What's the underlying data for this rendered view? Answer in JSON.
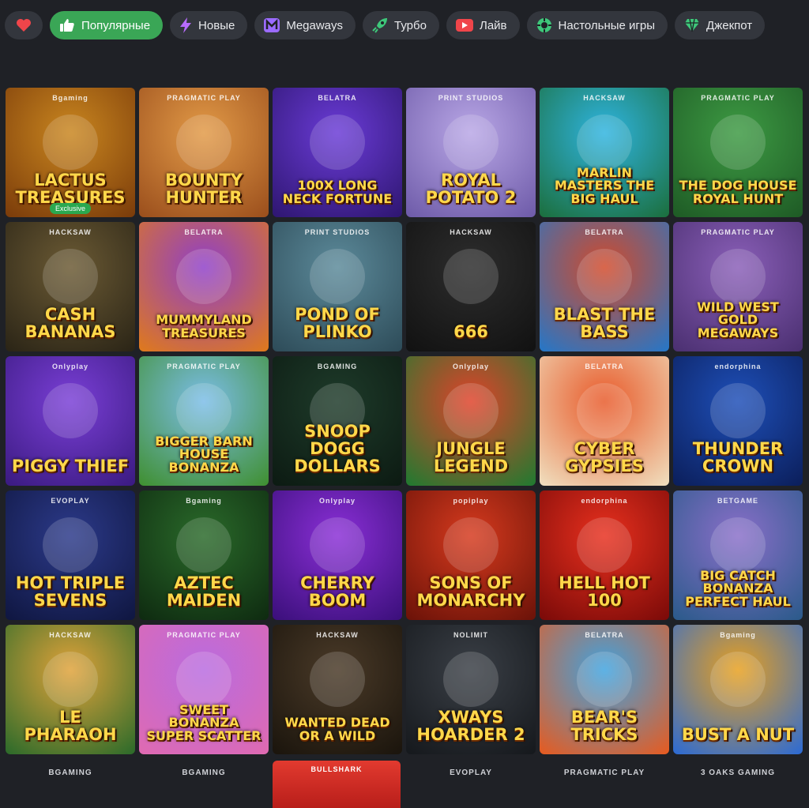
{
  "filters": [
    {
      "label": "",
      "icon": "heart-icon",
      "icon_color": "#f0454a",
      "active": false
    },
    {
      "label": "Популярные",
      "icon": "thumbs-up-icon",
      "icon_color": "#ffffff",
      "active": true
    },
    {
      "label": "Новые",
      "icon": "lightning-icon",
      "icon_color": "#b86bff",
      "active": false
    },
    {
      "label": "Megaways",
      "icon": "megaways-icon",
      "icon_color": "#9b6bff",
      "active": false
    },
    {
      "label": "Турбо",
      "icon": "rocket-icon",
      "icon_color": "#3ec77a",
      "active": false
    },
    {
      "label": "Лайв",
      "icon": "video-camera-icon",
      "icon_color": "#f0454a",
      "active": false
    },
    {
      "label": "Настольные игры",
      "icon": "chip-icon",
      "icon_color": "#3ec77a",
      "active": false
    },
    {
      "label": "Джекпот",
      "icon": "diamond-icon",
      "icon_color": "#3ec77a",
      "active": false
    }
  ],
  "games": [
    {
      "title": "Lactus Treasures",
      "provider": "Bgaming",
      "badge": "Exclusive",
      "bg": "#c9861f",
      "bg2": "#7a3b0a"
    },
    {
      "title": "Bounty Hunter",
      "provider": "PRAGMATIC PLAY",
      "badge": "",
      "bg": "#e29a47",
      "bg2": "#9a4e1c"
    },
    {
      "title": "100x Long Neck Fortune",
      "provider": "BELATRA",
      "badge": "",
      "bg": "#6a3bd6",
      "bg2": "#2e1670"
    },
    {
      "title": "Royal Potato 2",
      "provider": "PRINT STUDIOS",
      "badge": "",
      "bg": "#b9a7e6",
      "bg2": "#6d5aa8"
    },
    {
      "title": "Marlin Masters The Big Haul",
      "provider": "HACKSAW",
      "badge": "",
      "bg": "#2fb4e0",
      "bg2": "#1b6e3c"
    },
    {
      "title": "The Dog House Royal Hunt",
      "provider": "PRAGMATIC PLAY",
      "badge": "",
      "bg": "#3d9a43",
      "bg2": "#1e5a25"
    },
    {
      "title": "Cash Bananas",
      "provider": "HACKSAW",
      "badge": "",
      "bg": "#6b5a34",
      "bg2": "#2a2416"
    },
    {
      "title": "Mummyland Treasures",
      "provider": "BELATRA",
      "badge": "",
      "bg": "#8f3fc9",
      "bg2": "#e07a1a"
    },
    {
      "title": "Pond of Plinko",
      "provider": "PRINT STUDIOS",
      "badge": "",
      "bg": "#5c8a9a",
      "bg2": "#2d4b58"
    },
    {
      "title": "666",
      "provider": "HACKSAW",
      "badge": "",
      "bg": "#2d2d2d",
      "bg2": "#111111"
    },
    {
      "title": "Blast the Bass",
      "provider": "BELATRA",
      "badge": "",
      "bg": "#d24a2a",
      "bg2": "#2477c9"
    },
    {
      "title": "Wild West Gold Megaways",
      "provider": "PRAGMATIC PLAY",
      "badge": "",
      "bg": "#8a5fb8",
      "bg2": "#4a2f70"
    },
    {
      "title": "Piggy Thief",
      "provider": "Onlyplay",
      "badge": "",
      "bg": "#7a3fd6",
      "bg2": "#3a1a80"
    },
    {
      "title": "Bigger Barn House Bonanza",
      "provider": "PRAGMATIC PLAY",
      "badge": "",
      "bg": "#7bbde8",
      "bg2": "#3f8f2f"
    },
    {
      "title": "Snoop Dogg Dollars",
      "provider": "BGAMING",
      "badge": "",
      "bg": "#1e3b2a",
      "bg2": "#0c1a12"
    },
    {
      "title": "Jungle Legend",
      "provider": "Onlyplay",
      "badge": "",
      "bg": "#e0422a",
      "bg2": "#1f7a30"
    },
    {
      "title": "Cyber Gypsies",
      "provider": "BELATRA",
      "badge": "",
      "bg": "#e85a2a",
      "bg2": "#f0e0c0"
    },
    {
      "title": "Thunder Crown",
      "provider": "endorphina",
      "badge": "",
      "bg": "#1e4fb8",
      "bg2": "#0b1e5a"
    },
    {
      "title": "Hot Triple Sevens",
      "provider": "EVOPLAY",
      "badge": "",
      "bg": "#2c3a8a",
      "bg2": "#0f1640"
    },
    {
      "title": "Aztec Maiden",
      "provider": "Bgaming",
      "badge": "",
      "bg": "#2a6a2a",
      "bg2": "#0e2a10"
    },
    {
      "title": "Cherry Boom",
      "provider": "Onlyplay",
      "badge": "",
      "bg": "#8a2fd6",
      "bg2": "#3a0f7a"
    },
    {
      "title": "Sons of Monarchy",
      "provider": "popiplay",
      "badge": "",
      "bg": "#d63a1e",
      "bg2": "#6a1208"
    },
    {
      "title": "Hell Hot 100",
      "provider": "endorphina",
      "badge": "",
      "bg": "#e8301e",
      "bg2": "#7a0a08"
    },
    {
      "title": "Big Catch Bonanza Perfect Haul",
      "provider": "BETGAME",
      "badge": "",
      "bg": "#8a6fc9",
      "bg2": "#2a5a8a"
    },
    {
      "title": "Le Pharaoh",
      "provider": "HACKSAW",
      "badge": "",
      "bg": "#e0a23a",
      "bg2": "#2a6a2a"
    },
    {
      "title": "Sweet Bonanza Super Scatter",
      "provider": "PRAGMATIC PLAY",
      "badge": "",
      "bg": "#b86be0",
      "bg2": "#e06ab0"
    },
    {
      "title": "Wanted Dead or a Wild",
      "provider": "HACKSAW",
      "badge": "",
      "bg": "#4a3a28",
      "bg2": "#1a140c"
    },
    {
      "title": "xWays Hoarder 2",
      "provider": "NOLIMIT",
      "badge": "",
      "bg": "#3a3f46",
      "bg2": "#15181c"
    },
    {
      "title": "Bear's Tricks",
      "provider": "BELATRA",
      "badge": "",
      "bg": "#3fa3e0",
      "bg2": "#e85a1e"
    },
    {
      "title": "Bust a Nut",
      "provider": "Bgaming",
      "badge": "",
      "bg": "#e8a01e",
      "bg2": "#2a6ad6"
    }
  ],
  "providers_row": [
    "BGAMING",
    "BGAMING",
    "",
    "EVOPLAY",
    "PRAGMATIC PLAY",
    "3 OAKS GAMING"
  ],
  "partial_tile": {
    "provider": "BULLSHARK"
  }
}
